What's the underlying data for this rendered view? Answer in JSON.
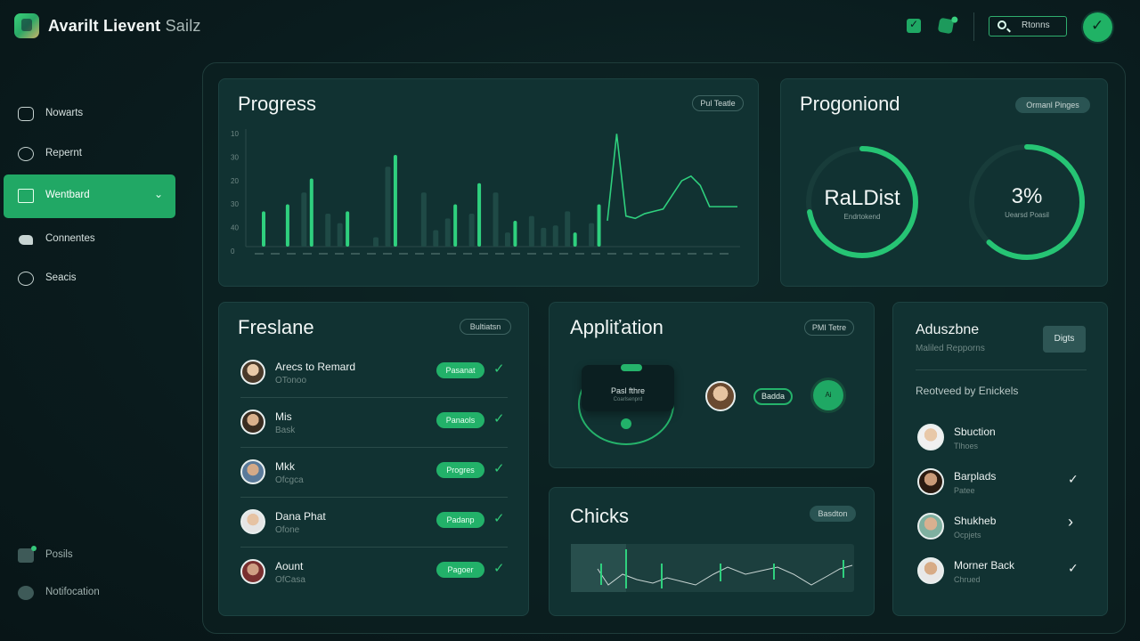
{
  "app": {
    "title_bold": "Avarilt Lievent",
    "title_thin": "Sailz",
    "search_label": "Rtonns"
  },
  "sidebar": {
    "items": [
      {
        "label": "Nowarts",
        "icon": "inbox-icon"
      },
      {
        "label": "Repernt",
        "icon": "chat-icon"
      },
      {
        "label": "Wentbard",
        "icon": "dashboard-icon",
        "active": true
      },
      {
        "label": "Connentes",
        "icon": "bird-icon"
      },
      {
        "label": "Seacis",
        "icon": "search-circle-icon"
      }
    ],
    "bottom_items": [
      {
        "label": "Posils",
        "icon": "posts-icon"
      },
      {
        "label": "Notifocation",
        "icon": "notification-icon"
      }
    ]
  },
  "progress": {
    "title": "Progress",
    "pill": "Pul Teatle",
    "y_ticks": [
      "10",
      "30",
      "20",
      "30",
      "40",
      "0"
    ]
  },
  "chart_data": {
    "type": "bar",
    "y_tick_labels": [
      "10",
      "30",
      "20",
      "30",
      "40",
      "0"
    ],
    "series": [
      {
        "values": [
          30,
          0,
          36,
          0,
          58,
          0,
          0,
          30,
          0,
          0,
          0,
          78,
          0,
          0,
          0,
          0,
          36,
          0,
          54,
          0,
          0,
          22,
          0,
          0,
          0,
          0,
          12,
          0,
          36
        ]
      },
      {
        "values": [
          0,
          0,
          0,
          46,
          0,
          28,
          20,
          0,
          0,
          8,
          68,
          0,
          0,
          46,
          14,
          24,
          0,
          28,
          0,
          46,
          12,
          0,
          26,
          16,
          18,
          30,
          0,
          20,
          0
        ]
      }
    ],
    "line_series": {
      "values": [
        22,
        96,
        26,
        24,
        28,
        30,
        32,
        44,
        56,
        60,
        52,
        34,
        34,
        34,
        34
      ]
    }
  },
  "progonind": {
    "title": "Progoniond",
    "pill": "Ormanl Pinges",
    "ring1": {
      "value": "RaLDist",
      "caption": "Endrtokend",
      "progress": 0.72
    },
    "ring2": {
      "value": "3%",
      "caption": "Uearsd Poasil",
      "progress": 0.62
    },
    "accent": "#26c474"
  },
  "freelane": {
    "title": "Freslane",
    "pill": "Bultiatsn",
    "rows": [
      {
        "name": "Arecs to Remard",
        "sub": "OTonoo",
        "status": "Pasanat"
      },
      {
        "name": "Mis",
        "sub": "Bask",
        "status": "Panaols"
      },
      {
        "name": "Mkk",
        "sub": "Ofcgca",
        "status": "Progres"
      },
      {
        "name": "Dana Phat",
        "sub": "Ofone",
        "status": "Padanp"
      },
      {
        "name": "Aount",
        "sub": "OfCasa",
        "status": "Pagoer"
      }
    ]
  },
  "applitation": {
    "title": "Appliťation",
    "pill": "PMI Tetre",
    "bubble_title": "Pasl fthre",
    "bubble_sub": "Coarlsenprd",
    "button": "Badda",
    "circle": "Ai"
  },
  "chicks": {
    "title": "Chicks",
    "pill": "Basdton"
  },
  "aduszbne": {
    "title": "Aduszbne",
    "sub": "Maliled Repporns",
    "button": "Digts",
    "section": "Reotveed by Enickels",
    "rows": [
      {
        "name": "Sbuction",
        "sub": "Tlhoes",
        "action": ""
      },
      {
        "name": "Barplads",
        "sub": "Patee",
        "action": "✓"
      },
      {
        "name": "Shukheb",
        "sub": "Ocpjets",
        "action": "›"
      },
      {
        "name": "Morner Back",
        "sub": "Chrued",
        "action": "✓"
      }
    ]
  }
}
